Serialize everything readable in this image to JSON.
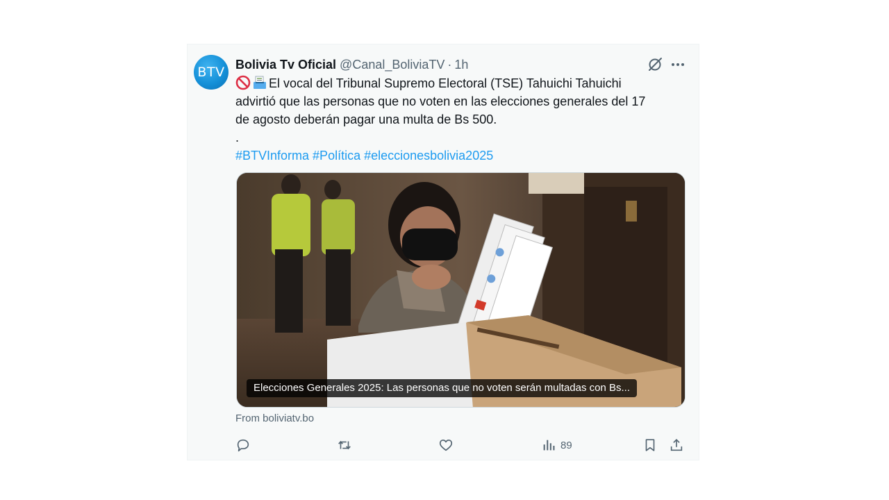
{
  "tweet": {
    "avatar_text": "BTV",
    "author_name": "Bolivia Tv Oficial",
    "handle": "@Canal_BoliviaTV",
    "separator": "·",
    "time": "1h",
    "text_lines": [
      "El vocal del Tribunal Supremo Electoral (TSE) Tahuichi Tahuichi",
      "advirtió que las personas que no voten en las elecciones generales del 17",
      "de agosto deberán pagar una multa de Bs 500.",
      "."
    ],
    "hashtags": [
      "#BTVInforma",
      "#Política",
      "#eleccionesbolivia2025"
    ],
    "link_card": {
      "caption": "Elecciones Generales 2025: Las personas que no voten serán multadas con Bs...",
      "source": "From boliviatv.bo"
    },
    "views_count": "89"
  },
  "colors": {
    "link_blue": "#1d9bf0",
    "muted_text": "#536471",
    "primary_text": "#0f1419"
  }
}
